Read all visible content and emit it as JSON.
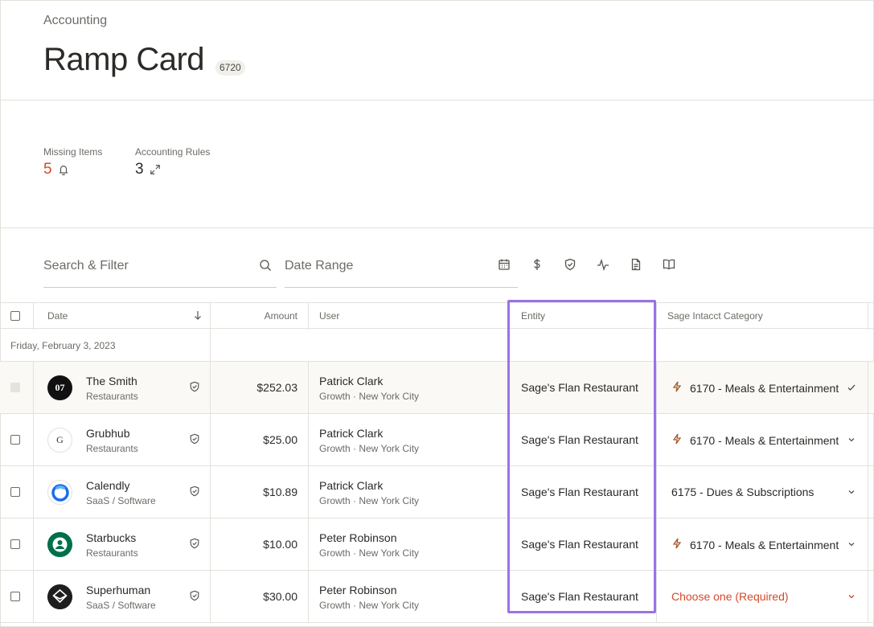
{
  "header": {
    "breadcrumb": "Accounting",
    "title": "Ramp Card",
    "badge": "6720"
  },
  "stats": {
    "missing_items": {
      "label": "Missing Items",
      "value": "5",
      "icon": "bell-icon"
    },
    "accounting_rules": {
      "label": "Accounting Rules",
      "value": "3",
      "icon": "expand-icon"
    }
  },
  "filters": {
    "search_placeholder": "Search & Filter",
    "date_placeholder": "Date Range",
    "tool_icons": [
      "calendar-icon",
      "dollar-icon",
      "shield-check-icon",
      "activity-icon",
      "document-icon",
      "book-icon"
    ]
  },
  "table": {
    "columns": {
      "date": "Date",
      "amount": "Amount",
      "user": "User",
      "entity": "Entity",
      "category": "Sage Intacct Category"
    },
    "group_label": "Friday, February 3, 2023",
    "rows": [
      {
        "merchant": "The Smith",
        "merchant_category": "Restaurants",
        "amount": "$252.03",
        "user": "Patrick Clark",
        "dept": "Growth · New York City",
        "entity": "Sage's Flan Restaurant",
        "category": "6170 - Meals & Entertainment",
        "has_rule": true,
        "required": false,
        "logo": "the-smith-logo",
        "logo_text": "07",
        "logo_bg": "#111111",
        "logo_fg": "#ffffff",
        "status": "confirmed"
      },
      {
        "merchant": "Grubhub",
        "merchant_category": "Restaurants",
        "amount": "$25.00",
        "user": "Patrick Clark",
        "dept": "Growth · New York City",
        "entity": "Sage's Flan Restaurant",
        "category": "6170 - Meals & Entertainment",
        "has_rule": true,
        "required": false,
        "logo": "grubhub-logo",
        "logo_text": "G",
        "logo_bg": "#ffffff",
        "logo_fg": "#333333",
        "status": "dropdown"
      },
      {
        "merchant": "Calendly",
        "merchant_category": "SaaS / Software",
        "amount": "$10.89",
        "user": "Patrick Clark",
        "dept": "Growth · New York City",
        "entity": "Sage's Flan Restaurant",
        "category": "6175 - Dues & Subscriptions",
        "has_rule": false,
        "required": false,
        "logo": "calendly-logo",
        "logo_text": "",
        "logo_bg": "#ffffff",
        "logo_fg": "#1a6cf0",
        "status": "dropdown"
      },
      {
        "merchant": "Starbucks",
        "merchant_category": "Restaurants",
        "amount": "$10.00",
        "user": "Peter Robinson",
        "dept": "Growth · New York City",
        "entity": "Sage's Flan Restaurant",
        "category": "6170 - Meals & Entertainment",
        "has_rule": true,
        "required": false,
        "logo": "starbucks-logo",
        "logo_text": "",
        "logo_bg": "#00704a",
        "logo_fg": "#ffffff",
        "status": "dropdown"
      },
      {
        "merchant": "Superhuman",
        "merchant_category": "SaaS / Software",
        "amount": "$30.00",
        "user": "Peter Robinson",
        "dept": "Growth · New York City",
        "entity": "Sage's Flan Restaurant",
        "category": "Choose one (Required)",
        "has_rule": false,
        "required": true,
        "logo": "superhuman-logo",
        "logo_text": "",
        "logo_bg": "#1e1e1e",
        "logo_fg": "#ffffff",
        "status": "dropdown"
      }
    ]
  },
  "colors": {
    "accent_red": "#d24a2a",
    "highlight_purple": "#9b72e8",
    "bolt_brown": "#a35a2e"
  }
}
